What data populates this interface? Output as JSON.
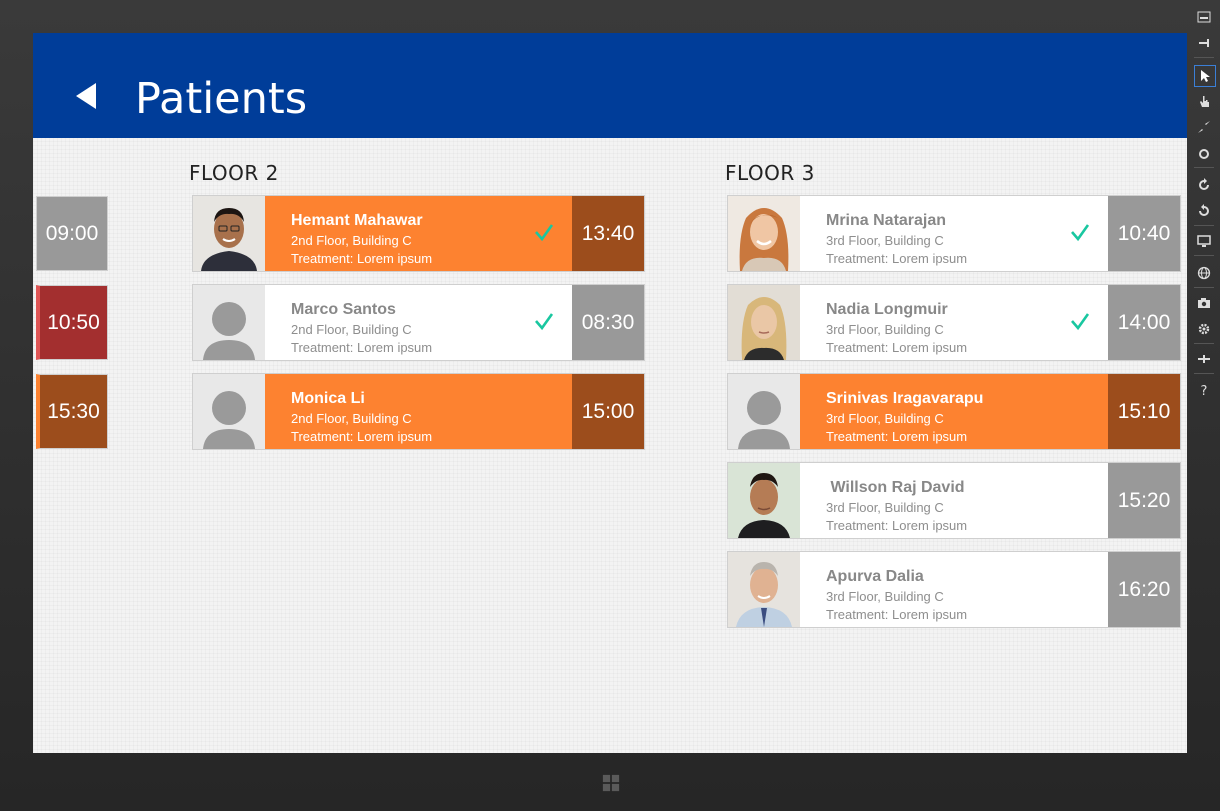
{
  "header": {
    "title": "Patients"
  },
  "floors": [
    {
      "label": "FLOOR 2"
    },
    {
      "label": "FLOOR 3"
    }
  ],
  "time_column": [
    "09:00",
    "10:50",
    "15:30"
  ],
  "floor2": [
    {
      "name": "Hemant Mahawar",
      "location": "2nd Floor, Building C",
      "treatment": "Treatment: Lorem ipsum",
      "time": "13:40"
    },
    {
      "name": "Marco Santos",
      "location": "2nd Floor, Building C",
      "treatment": "Treatment: Lorem ipsum",
      "time": "08:30"
    },
    {
      "name": "Monica Li",
      "location": "2nd Floor, Building C",
      "treatment": "Treatment: Lorem ipsum",
      "time": "15:00"
    }
  ],
  "floor3": [
    {
      "name": "Mrina Natarajan",
      "location": "3rd Floor, Building C",
      "treatment": "Treatment: Lorem ipsum",
      "time": "10:40"
    },
    {
      "name": "Nadia Longmuir",
      "location": "3rd Floor, Building C",
      "treatment": "Treatment: Lorem ipsum",
      "time": "14:00"
    },
    {
      "name": "Srinivas Iragavarapu",
      "location": "3rd Floor, Building C",
      "treatment": "Treatment: Lorem ipsum",
      "time": "15:10"
    },
    {
      "name": " Willson Raj David",
      "location": "3rd Floor, Building C",
      "treatment": "Treatment: Lorem ipsum",
      "time": "15:20"
    },
    {
      "name": "Apurva Dalia",
      "location": "3rd Floor, Building C",
      "treatment": "Treatment: Lorem ipsum",
      "time": "16:20"
    }
  ],
  "colors": {
    "header": "#003d99",
    "accent_orange": "#fd8230",
    "time_brown": "#9c4d1c",
    "time_gray": "#999999",
    "time_red": "#a32f2f",
    "check": "#19c7a0"
  },
  "icons": [
    "back-arrow-icon",
    "checkmark-icon",
    "avatar-placeholder-icon",
    "windows-logo-icon"
  ]
}
